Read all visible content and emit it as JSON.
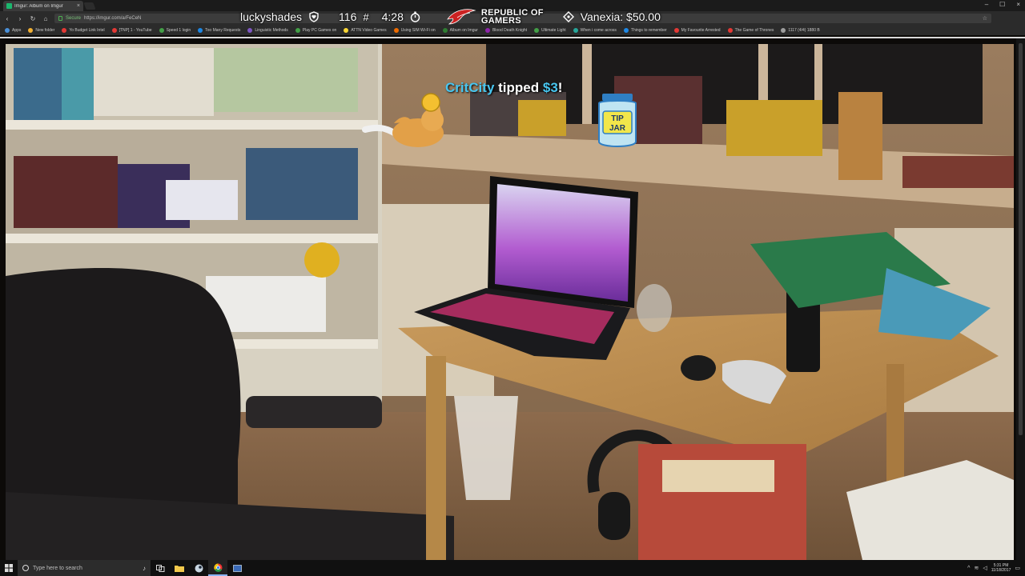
{
  "browser": {
    "tab_title": "Imgur: Album on Imgur",
    "tab_close": "×",
    "window_controls": [
      "–",
      "☐",
      "×"
    ],
    "nav": {
      "back": "‹",
      "forward": "›",
      "reload": "↻",
      "home": "⌂"
    },
    "secure_label": "Secure",
    "url": "https://imgur.com/a/FeCeN",
    "bookmarks": [
      {
        "label": "Apps",
        "color": "#4a90d9"
      },
      {
        "label": "New folder",
        "color": "#f2b134"
      },
      {
        "label": "Yo Budget Link Intel",
        "color": "#e53935"
      },
      {
        "label": "[TNP] 1 - YouTube",
        "color": "#e53935"
      },
      {
        "label": "Speed 1 login",
        "color": "#43a047"
      },
      {
        "label": "Too Many Requests",
        "color": "#1e88e5"
      },
      {
        "label": "Linguistic Methods",
        "color": "#7e57c2"
      },
      {
        "label": "Play PC Games on",
        "color": "#43a047"
      },
      {
        "label": "ATTN Video Games",
        "color": "#fdd835"
      },
      {
        "label": "Using SIM Wi-Fi on",
        "color": "#ef6c00"
      },
      {
        "label": "Album on Imgur",
        "color": "#2e7d32"
      },
      {
        "label": "Blood Death Knight",
        "color": "#8e24aa"
      },
      {
        "label": "Ultimate Light",
        "color": "#43a047"
      },
      {
        "label": "When i come across",
        "color": "#26a69a"
      },
      {
        "label": "Things to remember",
        "color": "#1e88e5"
      },
      {
        "label": "My Favourite Arrested",
        "color": "#e53935"
      },
      {
        "label": "The Game of Thrones",
        "color": "#e53935"
      },
      {
        "label": "1117 (4/4) 1880 B",
        "color": "#9e9e9e"
      }
    ]
  },
  "overlay": {
    "username": "luckyshades",
    "count": "116",
    "time": "4:28",
    "brand_line1": "REPUBLIC OF",
    "brand_line2": "GAMERS",
    "tip_status": "Vanexia: $50.00"
  },
  "alert": {
    "user": "CritCity",
    "verb": " tipped ",
    "amount": "$3",
    "punct": "!",
    "jar_line1": "TIP",
    "jar_line2": "JAR"
  },
  "taskbar": {
    "search_placeholder": "Type here to search",
    "clock_time": "5:31 PM",
    "clock_date": "11/18/2017"
  }
}
